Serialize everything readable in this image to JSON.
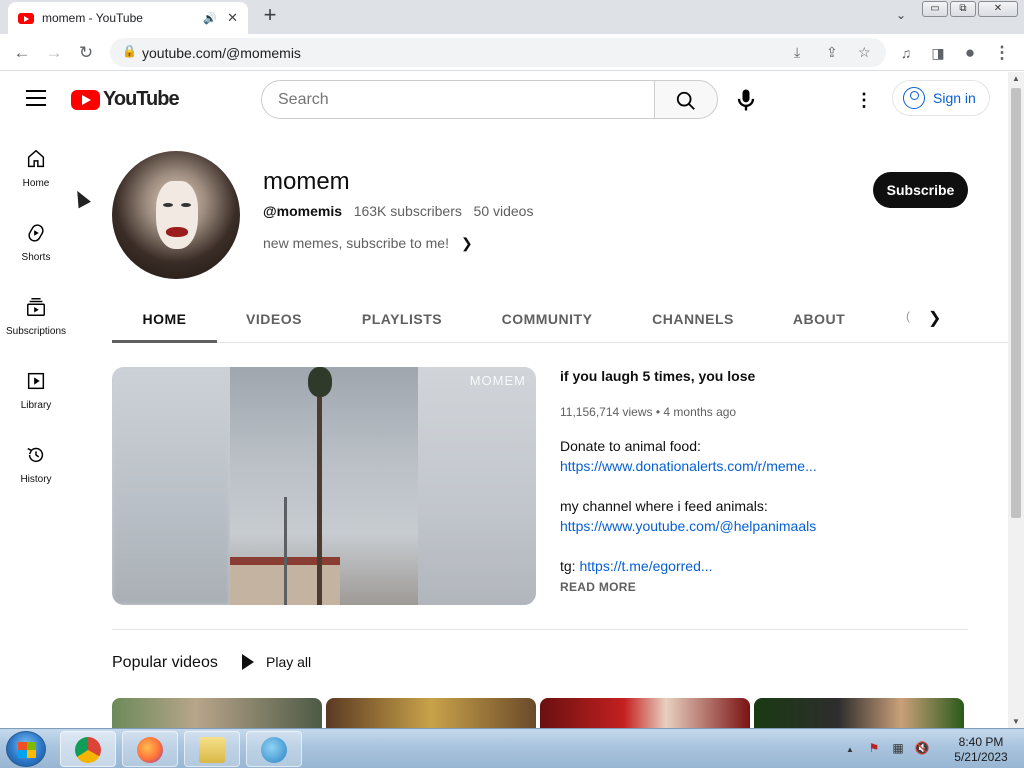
{
  "browser": {
    "tab_title": "momem - YouTube",
    "url": "youtube.com/@momemis",
    "window_min": "▭",
    "window_max": "⧉",
    "window_close": "✕"
  },
  "masthead": {
    "logo_text": "YouTube",
    "search_placeholder": "Search",
    "signin_label": "Sign in"
  },
  "sidebar": {
    "items": [
      {
        "label": "Home",
        "icon": "home-icon"
      },
      {
        "label": "Shorts",
        "icon": "shorts-icon"
      },
      {
        "label": "Subscriptions",
        "icon": "subscriptions-icon"
      },
      {
        "label": "Library",
        "icon": "library-icon"
      },
      {
        "label": "History",
        "icon": "history-icon"
      }
    ]
  },
  "channel": {
    "name": "momem",
    "handle": "@momemis",
    "subscribers": "163K subscribers",
    "videos": "50 videos",
    "description": "new memes, subscribe to me!",
    "subscribe_label": "Subscribe"
  },
  "tabs": [
    {
      "label": "HOME",
      "active": true
    },
    {
      "label": "VIDEOS",
      "active": false
    },
    {
      "label": "PLAYLISTS",
      "active": false
    },
    {
      "label": "COMMUNITY",
      "active": false
    },
    {
      "label": "CHANNELS",
      "active": false
    },
    {
      "label": "ABOUT",
      "active": false
    }
  ],
  "featured": {
    "watermark": "MOMEM",
    "title": "if you laugh 5 times, you lose",
    "views": "11,156,714 views",
    "age": "4 months ago",
    "desc_line1": "Donate to animal food:",
    "desc_link1": "https://www.donationalerts.com/r/meme...",
    "desc_line2": "my channel where i feed animals:",
    "desc_link2": "https://www.youtube.com/@helpanimaals",
    "desc_tg_prefix": "tg: ",
    "desc_tg_link": "https://t.me/egorred...",
    "read_more": "READ MORE"
  },
  "popular": {
    "heading": "Popular videos",
    "play_all": "Play all"
  },
  "taskbar": {
    "time": "8:40 PM",
    "date": "5/21/2023"
  },
  "colors": {
    "brand_red": "#ff0000",
    "link_blue": "#065fd4",
    "subscribe_bg": "#0f0f0f"
  }
}
